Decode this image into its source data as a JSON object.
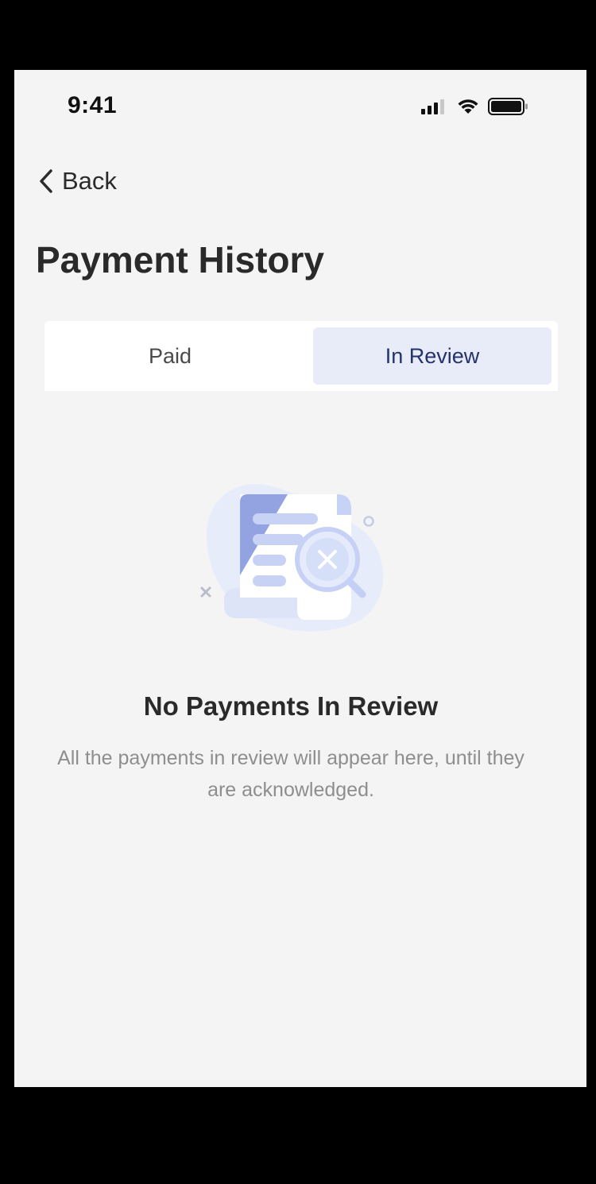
{
  "status_bar": {
    "time": "9:41",
    "icons": [
      "cellular-signal-icon",
      "wifi-icon",
      "battery-icon"
    ]
  },
  "nav": {
    "back_label": "Back",
    "back_icon": "chevron-left-icon"
  },
  "page": {
    "title": "Payment History"
  },
  "tabs": [
    {
      "label": "Paid",
      "selected": false
    },
    {
      "label": "In Review",
      "selected": true
    }
  ],
  "empty_state": {
    "illustration": "document-search-empty-illustration",
    "title": "No Payments In Review",
    "description": "All the payments in review will appear here, until they are acknowledged."
  },
  "colors": {
    "background": "#f4f4f4",
    "frame": "#000000",
    "selected_tab_bg": "#e8ebf8",
    "selected_tab_text": "#25336b",
    "illustration_accent": "#93a3e2"
  }
}
